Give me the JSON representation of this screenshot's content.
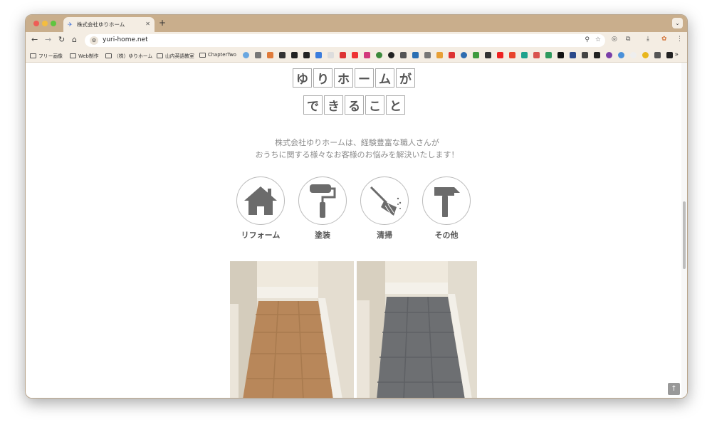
{
  "browser": {
    "tab_title": "株式会社ゆりホーム",
    "url": "yuri-home.net"
  },
  "bookmarks": {
    "folders": [
      "フリー画像",
      "Web制作",
      "（株）ゆりホーム",
      "山内英語教室",
      "ChapterTwo"
    ],
    "more": "»"
  },
  "page": {
    "title_line1": [
      "ゆ",
      "り",
      "ホ",
      "ー",
      "ム",
      "が"
    ],
    "title_line2": [
      "で",
      "き",
      "る",
      "こ",
      "と"
    ],
    "description_line1": "株式会社ゆりホームは、経験豊富な職人さんが",
    "description_line2": "おうちに関する様々なお客様のお悩みを解決いたします！",
    "services": [
      {
        "label": "リフォーム",
        "icon": "house-icon"
      },
      {
        "label": "塗装",
        "icon": "paint-roller-icon"
      },
      {
        "label": "清掃",
        "icon": "broom-icon"
      },
      {
        "label": "その他",
        "icon": "hammer-icon"
      }
    ]
  },
  "colors": {
    "tab_bar": "#c9ae8c",
    "toolbar": "#f4ede3",
    "icon_gray": "#6b6b6b",
    "text_gray": "#8c8c8c"
  }
}
